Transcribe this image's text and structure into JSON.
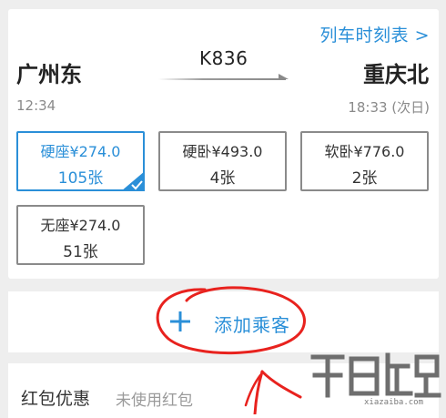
{
  "train": {
    "timetable_link": "列车时刻表 >",
    "from_station": "广州东",
    "to_station": "重庆北",
    "train_no": "K836",
    "depart_time": "12:34",
    "arrive_time": "18:33 (次日)"
  },
  "seats": [
    {
      "type_price": "硬座¥274.0",
      "count": "105张",
      "selected": true
    },
    {
      "type_price": "硬卧¥493.0",
      "count": "4张",
      "selected": false
    },
    {
      "type_price": "软卧¥776.0",
      "count": "2张",
      "selected": false
    },
    {
      "type_price": "无座¥274.0",
      "count": "51张",
      "selected": false
    }
  ],
  "passenger": {
    "add_label": "添加乘客",
    "add_icon": "plus-icon"
  },
  "coupon": {
    "title": "红包优惠",
    "status": "未使用红包"
  },
  "watermark": {
    "text": "xiazaiba.com"
  },
  "colors": {
    "accent": "#2a8fd8",
    "annotation": "#e8221e",
    "border": "#8a8a8a"
  }
}
